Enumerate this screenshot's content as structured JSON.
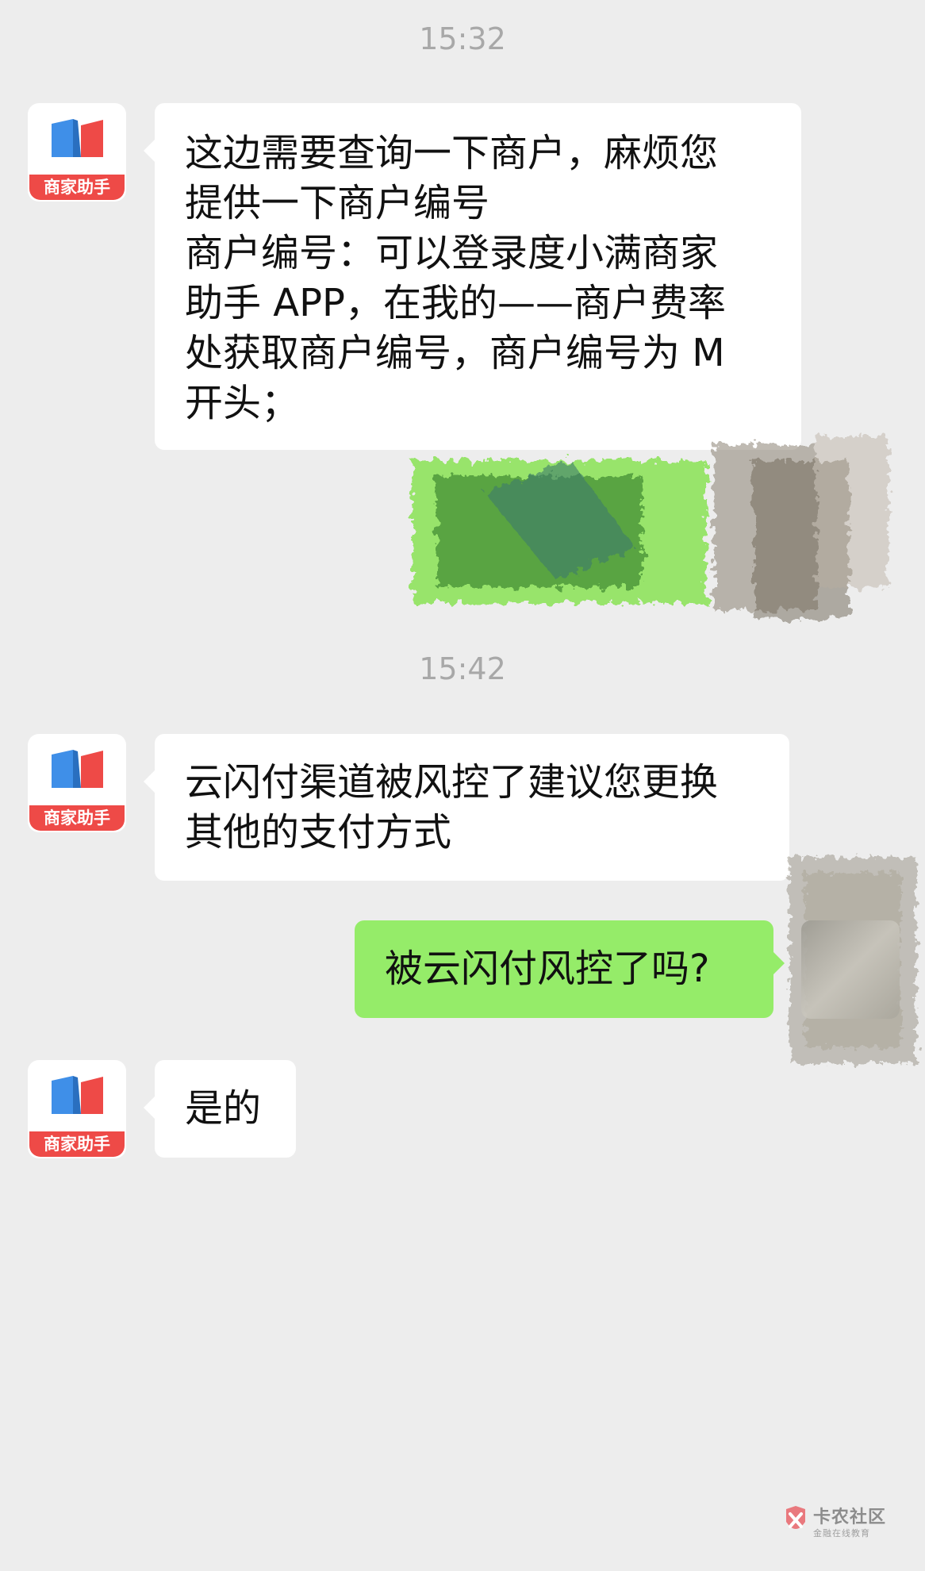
{
  "timestamps": [
    "15:32",
    "15:42"
  ],
  "merchant_avatar": {
    "label": "商家助手",
    "colors": {
      "blue": "#3f8fe8",
      "red": "#ee4a47"
    }
  },
  "messages": [
    {
      "sender": "merchant",
      "lines": [
        "这边需要查询一下商户，麻烦您",
        "提供一下商户编号",
        "商户编号：可以登录度小满商家",
        "助手 APP，在我的——商户费率",
        "处获取商户编号，商户编号为 M",
        "开头；"
      ]
    },
    {
      "sender": "merchant",
      "lines": [
        "云闪付渠道被风控了建议您更换",
        "其他的支付方式"
      ]
    },
    {
      "sender": "self",
      "lines": [
        "被云闪付风控了吗?"
      ]
    },
    {
      "sender": "merchant",
      "lines": [
        "是的"
      ]
    }
  ],
  "watermark": {
    "title": "卡农社区",
    "subtitle": "金融在线教育"
  },
  "colors": {
    "background": "#ededed",
    "self_bubble": "#95ec69",
    "other_bubble": "#ffffff",
    "timestamp": "#a8a8a8"
  }
}
